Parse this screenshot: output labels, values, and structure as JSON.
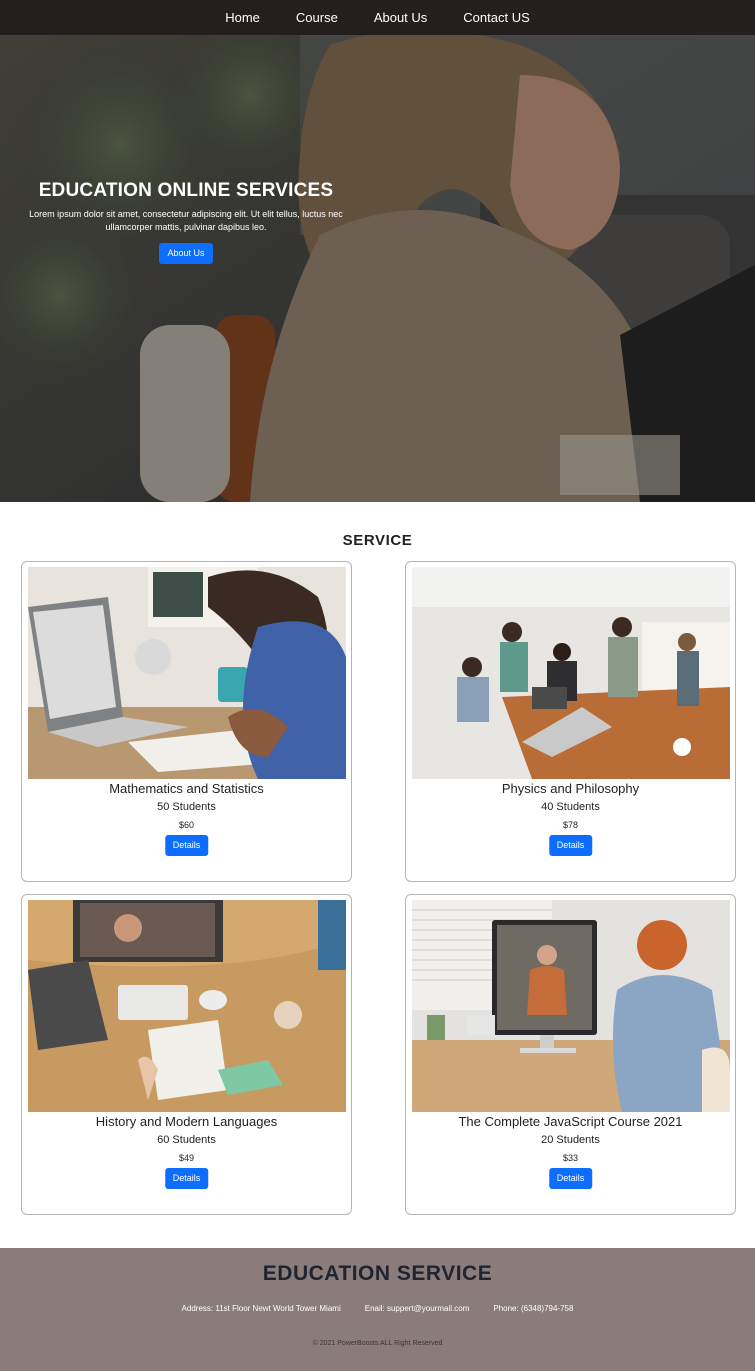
{
  "nav": {
    "items": [
      "Home",
      "Course",
      "About Us",
      "Contact US"
    ]
  },
  "hero": {
    "title": "EDUCATION ONLINE SERVICES",
    "description": "Lorem ipsum dolor sit amet, consectetur adipiscing elit. Ut elit tellus, luctus nec ullamcorper mattis, pulvinar dapibus leo.",
    "button_label": "About Us"
  },
  "service": {
    "title": "SERVICE",
    "cards": [
      {
        "title": "Mathematics and Statistics",
        "students": "50 Students",
        "price": "$60",
        "button_label": "Details"
      },
      {
        "title": "Physics and Philosophy",
        "students": "40 Students",
        "price": "$78",
        "button_label": "Details"
      },
      {
        "title": "History and Modern Languages",
        "students": "60 Students",
        "price": "$49",
        "button_label": "Details"
      },
      {
        "title": "The Complete JavaScript Course 2021",
        "students": "20 Students",
        "price": "$33",
        "button_label": "Details"
      }
    ]
  },
  "footer": {
    "title": "EDUCATION SERVICE",
    "address_label": "Address:",
    "address_value": "11st Floor Newt World Tower Miami",
    "email_label": "Enail:",
    "email_value": "suppert@yourmail.com",
    "phone_label": "Phone:",
    "phone_value": "(6348)794-758",
    "copyright": "© 2021 PowerBoosts ALL Right Reserved"
  },
  "colors": {
    "navbar": "#251e1e",
    "accent": "#0d6efd",
    "footer": "#8a7c7b"
  }
}
